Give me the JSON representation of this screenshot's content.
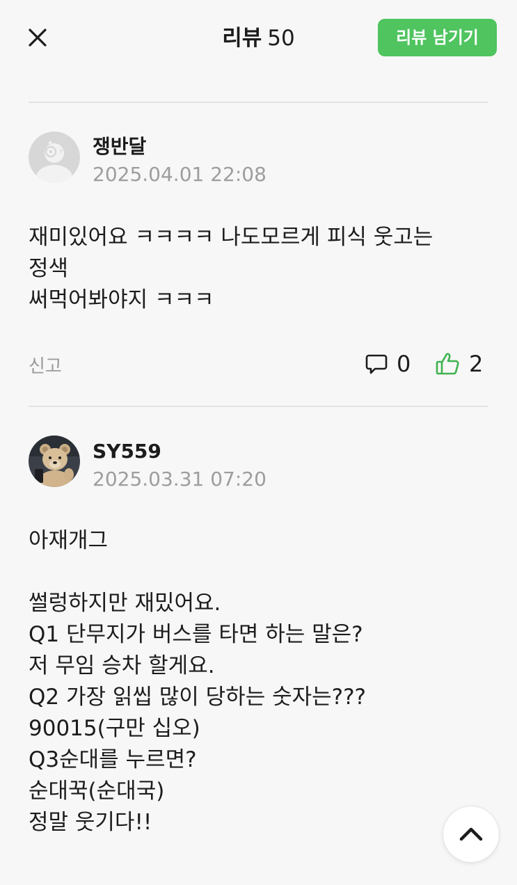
{
  "header": {
    "close_icon": "close-icon",
    "title": "리뷰",
    "count": "50",
    "write_button": "리뷰 남기기"
  },
  "reviews": [
    {
      "author": "쟁반달",
      "date": "2025.04.01 22:08",
      "body": "재미있어요 ㅋㅋㅋㅋ 나도모르게 피식 웃고는\n정색\n써먹어봐야지 ㅋㅋㅋ",
      "report": "신고",
      "comments": "0",
      "likes": "2",
      "avatar_icon": "default-bird-avatar"
    },
    {
      "author": "SY559",
      "date": "2025.03.31 07:20",
      "body": "아재개그\n\n썰렁하지만 재밌어요.\nQ1 단무지가 버스를 타면 하는 말은?\n저 무임 승차 할게요.\nQ2 가장 읽씹 많이 당하는 숫자는???\n90015(구만 십오)\nQ3순대를 누르면?\n순대꾹(순대국)\n정말 웃기다!!",
      "avatar_icon": "teddy-bear-avatar"
    }
  ],
  "colors": {
    "accent": "#4fc45f",
    "muted": "#9d9d9d",
    "divider": "#e2e2e2"
  },
  "scroll_top_icon": "chevron-up-icon"
}
